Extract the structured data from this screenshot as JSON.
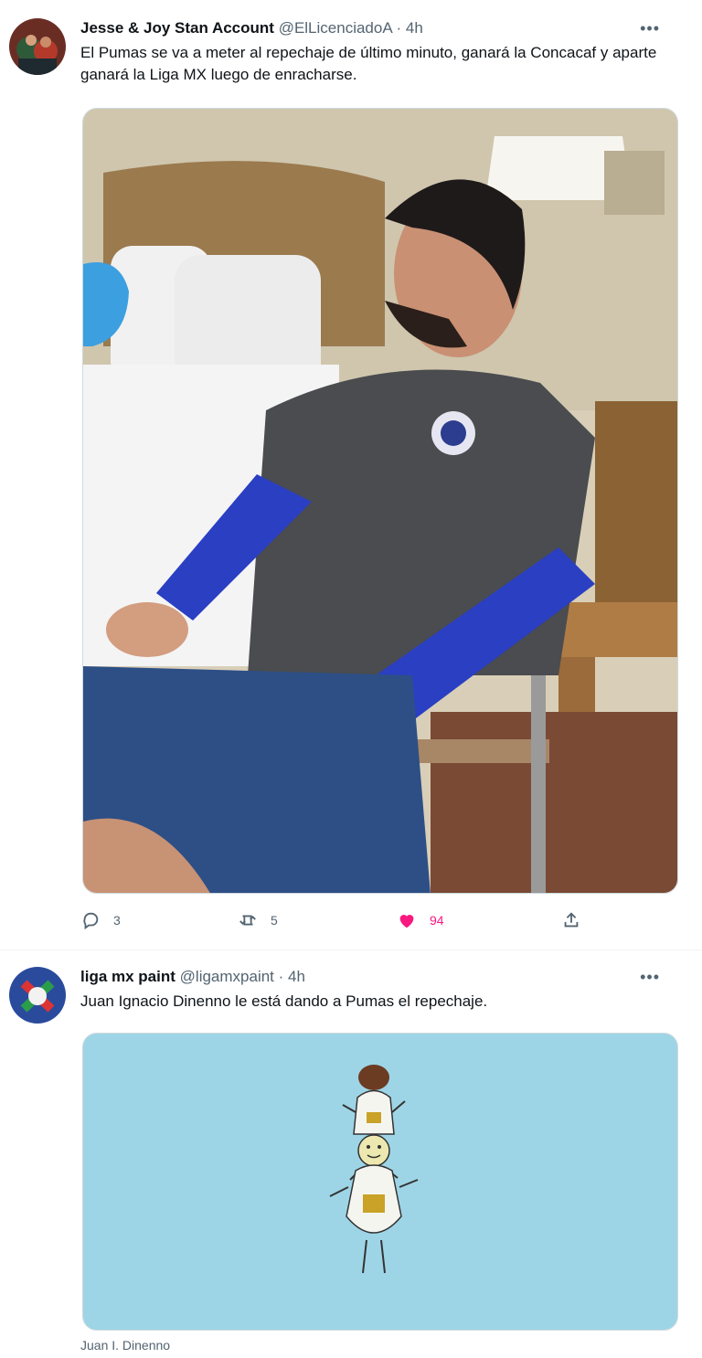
{
  "tweets": [
    {
      "name": "Jesse & Joy Stan Account",
      "handle": "@ElLicenciadoA",
      "separator": "·",
      "time": "4h",
      "more": "•••",
      "text": "El Pumas se va a meter al repechaje de último minuto, ganará la Concacaf y aparte ganará la Liga MX luego de enracharse.",
      "actions": {
        "replies": "3",
        "retweets": "5",
        "likes": "94"
      },
      "like_color": "#f91880"
    },
    {
      "name": "liga mx paint",
      "handle": "@ligamxpaint",
      "separator": "·",
      "time": "4h",
      "more": "•••",
      "text": "Juan Ignacio Dinenno le está dando a Pumas el repechaje.",
      "caption": "Juan I. Dinenno"
    }
  ],
  "icons": [
    "reply-icon",
    "retweet-icon",
    "like-icon",
    "share-icon"
  ]
}
